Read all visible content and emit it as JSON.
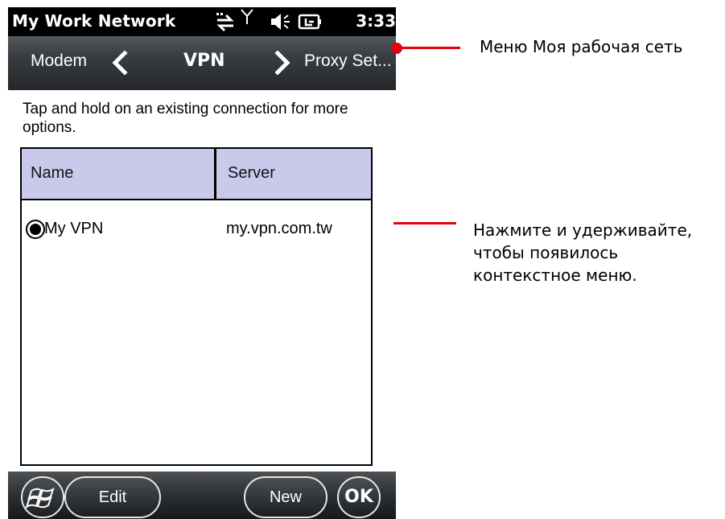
{
  "status_bar": {
    "title": "My Work Network",
    "time": "3:33",
    "icons": [
      "data-sync-icon",
      "signal-antenna-icon",
      "speaker-icon",
      "battery-charging-icon"
    ]
  },
  "nav": {
    "prev_label": "Modem",
    "current_label": "VPN",
    "next_label": "Proxy Set..."
  },
  "content": {
    "hint": "Tap and hold on an existing connection for more options.",
    "columns": [
      "Name",
      "Server"
    ],
    "rows": [
      {
        "name": "My VPN",
        "server": "my.vpn.com.tw",
        "selected": true
      }
    ]
  },
  "softkeys": {
    "edit_label": "Edit",
    "new_label": "New",
    "ok_label": "OK"
  },
  "callouts": {
    "menu_label": "Меню Моя рабочая сеть",
    "hold_line1": "Нажмите и удерживайте,",
    "hold_line2": "чтобы появилось",
    "hold_line3": "контекстное меню."
  },
  "colors": {
    "callout": "#e8000e",
    "header_fill": "#c9caeb"
  }
}
